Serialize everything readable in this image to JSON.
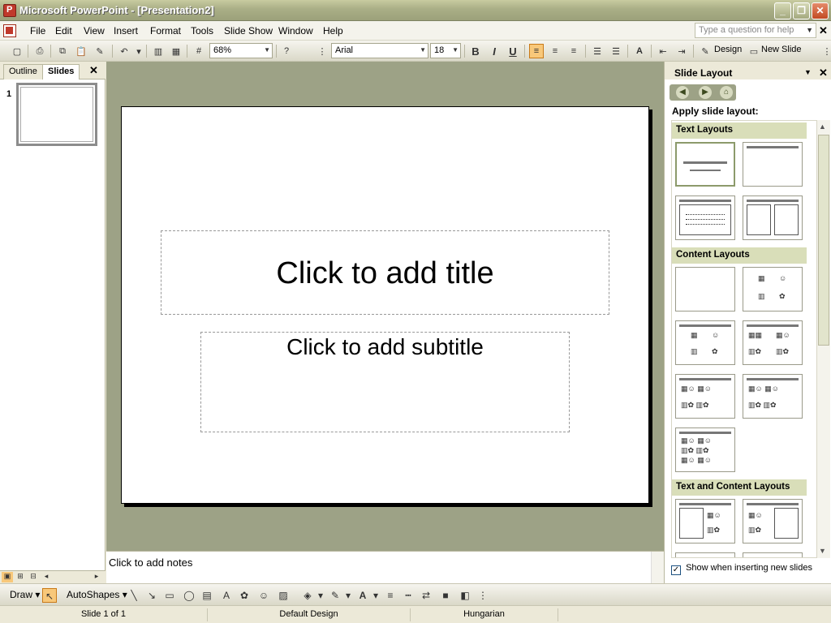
{
  "window": {
    "title": "Microsoft PowerPoint - [Presentation2]",
    "controls": [
      "_",
      "❐",
      "✕"
    ]
  },
  "menu": {
    "items": [
      "File",
      "Edit",
      "View",
      "Insert",
      "Format",
      "Tools",
      "Slide Show",
      "Window",
      "Help"
    ],
    "help_placeholder": "Type a question for help"
  },
  "toolbar": {
    "zoom": "68%",
    "font": "Arial",
    "font_size": "18",
    "bold": "B",
    "italic": "I",
    "underline": "U",
    "design_label": "Design",
    "new_slide_label": "New Slide"
  },
  "left_pane": {
    "tabs": [
      "Outline",
      "Slides"
    ],
    "active_tab": "Slides",
    "slide_numbers": [
      "1"
    ]
  },
  "slide": {
    "title_placeholder": "Click to add title",
    "subtitle_placeholder": "Click to add subtitle"
  },
  "notes": {
    "placeholder": "Click to add notes"
  },
  "task_pane": {
    "title": "Slide Layout",
    "apply_label": "Apply slide layout:",
    "sections": [
      "Text Layouts",
      "Content Layouts",
      "Text and Content Layouts"
    ],
    "show_checkbox_label": "Show when inserting new slides",
    "show_checked": true
  },
  "draw_toolbar": {
    "draw_label": "Draw",
    "autoshapes_label": "AutoShapes"
  },
  "status_bar": {
    "slide_info": "Slide 1 of 1",
    "design": "Default Design",
    "language": "Hungarian"
  },
  "colors": {
    "titlebar": "#A9AE86",
    "workspace": "#9DA286",
    "section_header": "#D9DEB9"
  }
}
